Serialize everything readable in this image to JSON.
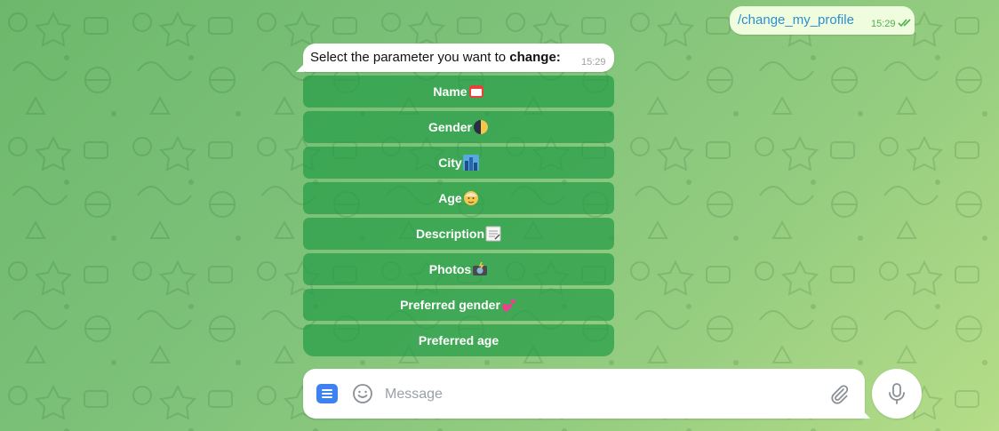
{
  "outgoing": {
    "text": "/change_my_profile",
    "time": "15:29"
  },
  "incoming": {
    "text_prefix": "Select the parameter you want to ",
    "text_bold": "change:",
    "time": "15:29"
  },
  "keyboard": [
    {
      "label": "Name",
      "icon": "name-badge-icon"
    },
    {
      "label": "Gender",
      "icon": "moon-icon"
    },
    {
      "label": "City",
      "icon": "cityscape-icon"
    },
    {
      "label": "Age",
      "icon": "old-person-icon"
    },
    {
      "label": "Description",
      "icon": "memo-icon"
    },
    {
      "label": "Photos",
      "icon": "camera-flash-icon"
    },
    {
      "label": "Preferred gender",
      "icon": "two-hearts-icon"
    },
    {
      "label": "Preferred age",
      "icon": ""
    }
  ],
  "composer": {
    "placeholder": "Message"
  },
  "colors": {
    "button_bg": "#2f9e4c",
    "link": "#2d8ecf",
    "accent": "#3e82f0"
  }
}
